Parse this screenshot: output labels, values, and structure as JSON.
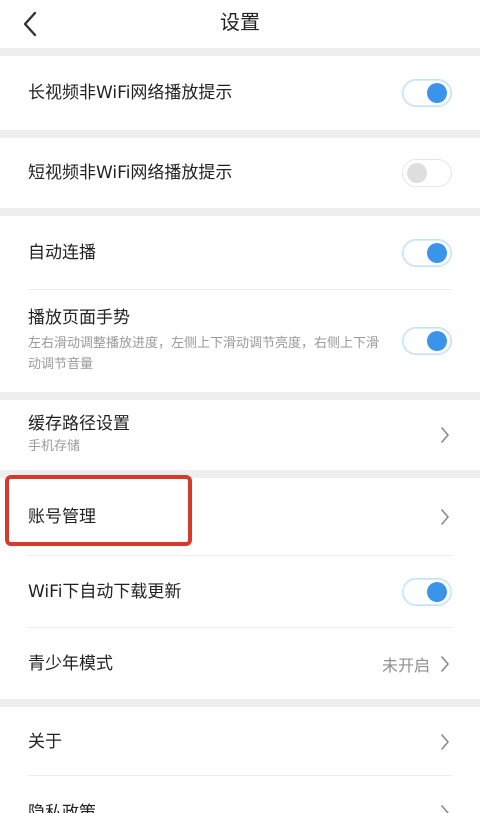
{
  "header": {
    "title": "设置",
    "back_icon": "chevron-left-icon"
  },
  "settings": {
    "long_video_wifi": {
      "label": "长视频非WiFi网络播放提示",
      "enabled": true
    },
    "short_video_wifi": {
      "label": "短视频非WiFi网络播放提示",
      "enabled": false
    },
    "autoplay": {
      "label": "自动连播",
      "enabled": true
    },
    "gesture": {
      "label": "播放页面手势",
      "description": "左右滑动调整播放进度，左侧上下滑动调节亮度，右侧上下滑动调节音量",
      "enabled": true
    },
    "cache_path": {
      "label": "缓存路径设置",
      "value": "手机存储"
    },
    "account": {
      "label": "账号管理"
    },
    "wifi_auto_update": {
      "label": "WiFi下自动下载更新",
      "enabled": true
    },
    "youth_mode": {
      "label": "青少年模式",
      "value": "未开启"
    },
    "about": {
      "label": "关于"
    },
    "privacy": {
      "label": "隐私政策"
    }
  },
  "colors": {
    "toggle_on": "#3a95ea",
    "toggle_off": "#dedede",
    "separator": "#eeeeee",
    "highlight": "#d63a2a"
  }
}
